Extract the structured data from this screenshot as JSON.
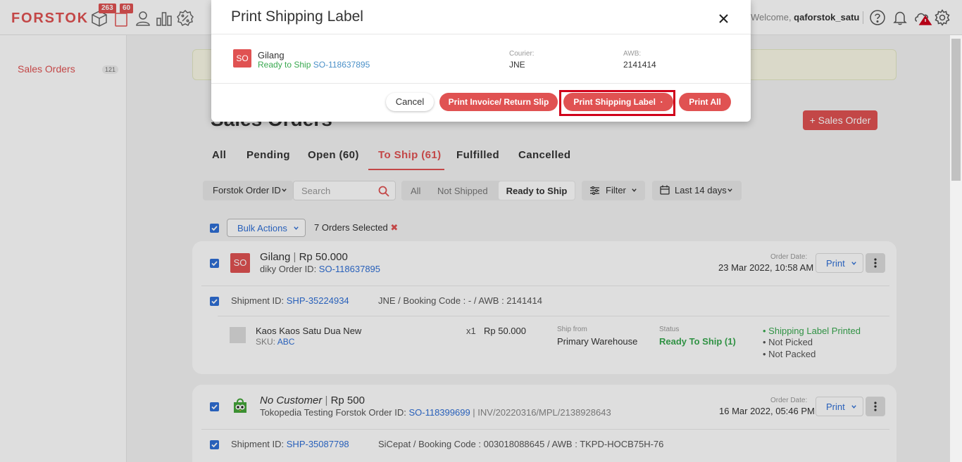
{
  "topbar": {
    "logo": "FORSTOK",
    "badge_count_1": "263",
    "badge_count_2": "60",
    "welcome_prefix": "Welcome, ",
    "username": "qaforstok_satu"
  },
  "sidebar": {
    "item_label": "Sales Orders",
    "item_count": "121"
  },
  "page": {
    "title": "Sales Orders",
    "add_button": "+ Sales Order"
  },
  "tabs": [
    {
      "label": "All"
    },
    {
      "label": "Pending"
    },
    {
      "label": "Open (60)"
    },
    {
      "label": "To Ship (61)"
    },
    {
      "label": "Fulfilled"
    },
    {
      "label": "Cancelled"
    }
  ],
  "filters": {
    "search_by": "Forstok Order ID",
    "search_placeholder": "Search",
    "seg_all": "All",
    "seg_not_shipped": "Not Shipped",
    "seg_ready": "Ready to Ship",
    "filter_label": "Filter",
    "date_label": "Last 14 days"
  },
  "bulk": {
    "button": "Bulk Actions",
    "selected_text": "7 Orders Selected"
  },
  "orders": [
    {
      "avatar": "SO",
      "customer": "Gilang",
      "amount": "Rp 50.000",
      "channel_prefix": "diky Order ID: ",
      "order_id": "SO-118637895",
      "order_date_label": "Order Date:",
      "order_date": "23 Mar 2022, 10:58 AM",
      "print_label": "Print",
      "shipment_prefix": "Shipment ID: ",
      "shipment_id": "SHP-35224934",
      "shipment_info": "JNE / Booking Code : - / AWB : 2141414",
      "item_name": "Kaos Kaos Satu Dua New",
      "sku_prefix": "SKU: ",
      "sku": "ABC",
      "qty": "x1",
      "price": "Rp 50.000",
      "ship_from_label": "Ship from",
      "ship_from": "Primary Warehouse",
      "status_label": "Status",
      "status": "Ready To Ship (1)",
      "checklist": [
        "Shipping Label Printed",
        "Not Picked",
        "Not Packed"
      ]
    },
    {
      "customer": "No Customer",
      "amount": "Rp 500",
      "channel_prefix": "Tokopedia Testing Forstok Order ID: ",
      "order_id": "SO-118399699",
      "invoice": "INV/20220316/MPL/2138928643",
      "order_date_label": "Order Date:",
      "order_date": "16 Mar 2022, 05:46 PM",
      "print_label": "Print",
      "shipment_prefix": "Shipment ID: ",
      "shipment_id": "SHP-35087798",
      "shipment_info": "SiCepat / Booking Code : 003018088645 / AWB : TKPD-HOCB75H-76"
    }
  ],
  "modal": {
    "title": "Print Shipping Label",
    "avatar": "SO",
    "customer": "Gilang",
    "status": "Ready to Ship",
    "order_id": "SO-118637895",
    "courier_label": "Courier:",
    "courier": "JNE",
    "awb_label": "AWB:",
    "awb": "2141414",
    "btn_cancel": "Cancel",
    "btn_invoice": "Print Invoice/ Return Slip",
    "btn_label": "Print Shipping Label",
    "btn_label_dot": "·",
    "btn_all": "Print All"
  },
  "colors": {
    "brand": "#e05252",
    "link": "#2f6fd6",
    "success": "#38a84f",
    "highlight": "#d0021b"
  }
}
